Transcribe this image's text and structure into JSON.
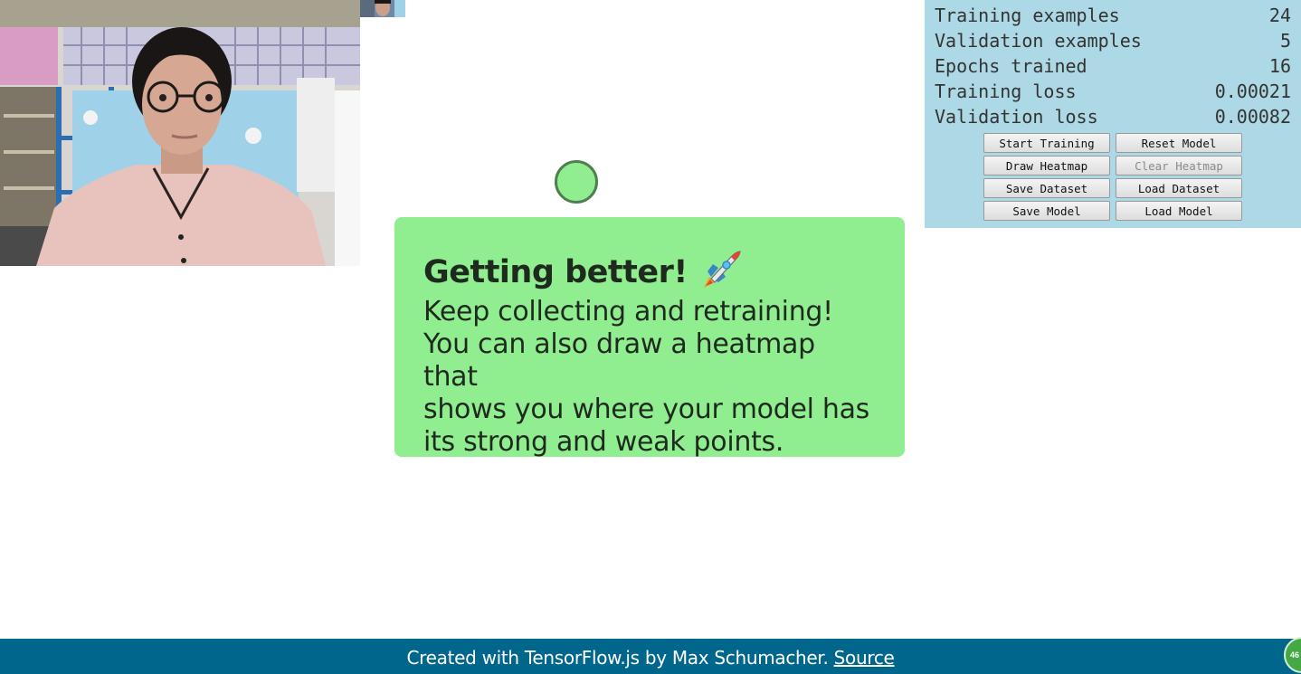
{
  "stats": [
    {
      "label": "Training examples",
      "value": "24"
    },
    {
      "label": "Validation examples",
      "value": "5"
    },
    {
      "label": "Epochs trained",
      "value": "16"
    },
    {
      "label": "Training loss",
      "value": "0.00021"
    },
    {
      "label": "Validation loss",
      "value": "0.00082"
    }
  ],
  "buttons": {
    "start_training": "Start Training",
    "reset_model": "Reset Model",
    "draw_heatmap": "Draw Heatmap",
    "clear_heatmap": "Clear Heatmap",
    "save_dataset": "Save Dataset",
    "load_dataset": "Load Dataset",
    "save_model": "Save Model",
    "load_model": "Load Model"
  },
  "info": {
    "title": "Getting better!",
    "title_icon": "rocket-icon",
    "lines": [
      "Keep collecting and retraining!",
      "You can also draw a heatmap that",
      "shows you where your model has",
      "its strong and weak points."
    ]
  },
  "footer": {
    "text": "Created with TensorFlow.js by Max Schumacher.",
    "link_label": "Source"
  },
  "badge": {
    "value": "46"
  },
  "colors": {
    "panel_bg": "#add8e6",
    "card_bg": "#90ee90",
    "target_fill": "#90ee90",
    "target_border": "#4f7f4f",
    "footer_bg": "#00668c"
  }
}
